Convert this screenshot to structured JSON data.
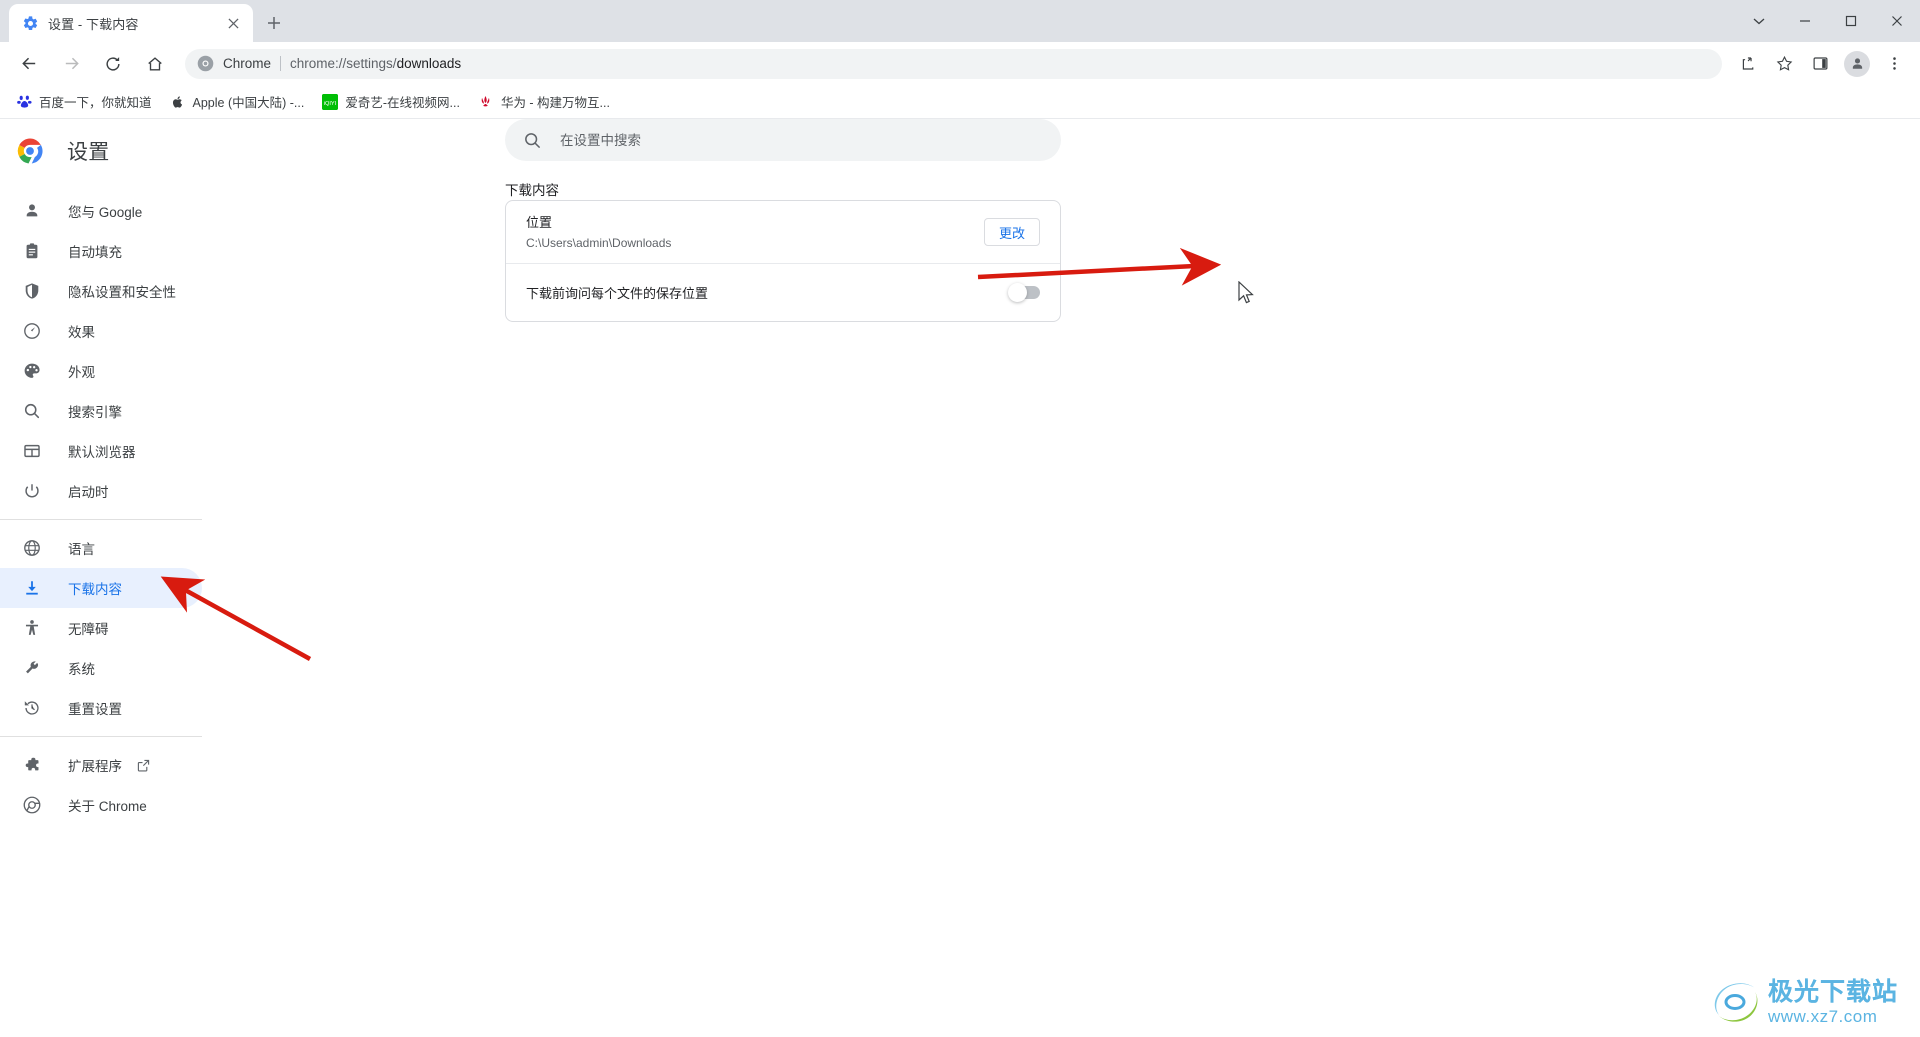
{
  "window": {
    "controls": [
      {
        "name": "tab-search-chevron",
        "glyph": "chevron-down"
      },
      {
        "name": "minimize",
        "glyph": "minimize"
      },
      {
        "name": "maximize",
        "glyph": "maximize"
      },
      {
        "name": "close",
        "glyph": "close"
      }
    ]
  },
  "tab": {
    "title": "设置 - 下载内容",
    "favicon": "settings-gear-icon",
    "close_label": "×",
    "new_tab_label": "+"
  },
  "toolbar": {
    "back": "返回",
    "forward": "前进",
    "reload": "重新加载",
    "home": "主页",
    "omnibox": {
      "chip": "Chrome",
      "url_scheme": "chrome://settings/",
      "url_path": "downloads",
      "url_full": "chrome://settings/downloads"
    },
    "right_icons": [
      {
        "name": "share-icon"
      },
      {
        "name": "bookmark-star-icon"
      },
      {
        "name": "side-panel-icon"
      },
      {
        "name": "profile-avatar"
      },
      {
        "name": "more-menu-icon"
      }
    ]
  },
  "bookmarks": [
    {
      "label": "百度一下，你就知道",
      "icon": "baidu-icon"
    },
    {
      "label": "Apple (中国大陆) -...",
      "icon": "apple-icon"
    },
    {
      "label": "爱奇艺-在线视频网...",
      "icon": "iqiyi-icon"
    },
    {
      "label": "华为 - 构建万物互...",
      "icon": "huawei-icon"
    }
  ],
  "sidebar": {
    "brand": "设置",
    "groups": [
      {
        "items": [
          {
            "label": "您与 Google",
            "icon": "person-icon",
            "active": false
          },
          {
            "label": "自动填充",
            "icon": "clipboard-icon",
            "active": false
          },
          {
            "label": "隐私设置和安全性",
            "icon": "shield-icon",
            "active": false
          },
          {
            "label": "效果",
            "icon": "speedometer-icon",
            "active": false
          },
          {
            "label": "外观",
            "icon": "palette-icon",
            "active": false
          },
          {
            "label": "搜索引擎",
            "icon": "search-icon",
            "active": false
          },
          {
            "label": "默认浏览器",
            "icon": "browser-window-icon",
            "active": false
          },
          {
            "label": "启动时",
            "icon": "power-icon",
            "active": false
          }
        ]
      },
      {
        "items": [
          {
            "label": "语言",
            "icon": "globe-icon",
            "active": false
          },
          {
            "label": "下载内容",
            "icon": "download-icon",
            "active": true
          },
          {
            "label": "无障碍",
            "icon": "accessibility-icon",
            "active": false
          },
          {
            "label": "系统",
            "icon": "wrench-icon",
            "active": false
          },
          {
            "label": "重置设置",
            "icon": "history-restore-icon",
            "active": false
          }
        ]
      },
      {
        "items": [
          {
            "label": "扩展程序",
            "icon": "puzzle-icon",
            "active": false,
            "external": true
          },
          {
            "label": "关于 Chrome",
            "icon": "chrome-icon",
            "active": false
          }
        ]
      }
    ]
  },
  "search": {
    "placeholder": "在设置中搜索",
    "value": "",
    "icon": "search-icon"
  },
  "main": {
    "section_title": "下载内容",
    "location": {
      "label": "位置",
      "path": "C:\\Users\\admin\\Downloads",
      "change_button": "更改"
    },
    "ask_each_time": {
      "label": "下载前询问每个文件的保存位置",
      "enabled": false
    }
  },
  "annotations": [
    {
      "name": "arrow-to-change-button",
      "color": "#d81b0f"
    },
    {
      "name": "arrow-to-downloads-nav",
      "color": "#d81b0f"
    }
  ],
  "watermark": {
    "title": "极光下载站",
    "url": "www.xz7.com"
  },
  "colors": {
    "accent": "#1a73e8",
    "active_bg": "#e8f0fe",
    "titlebar": "#dee1e6",
    "omnibox_bg": "#f1f3f4",
    "arrow_red": "#d81b0f",
    "border": "#dadce0"
  }
}
